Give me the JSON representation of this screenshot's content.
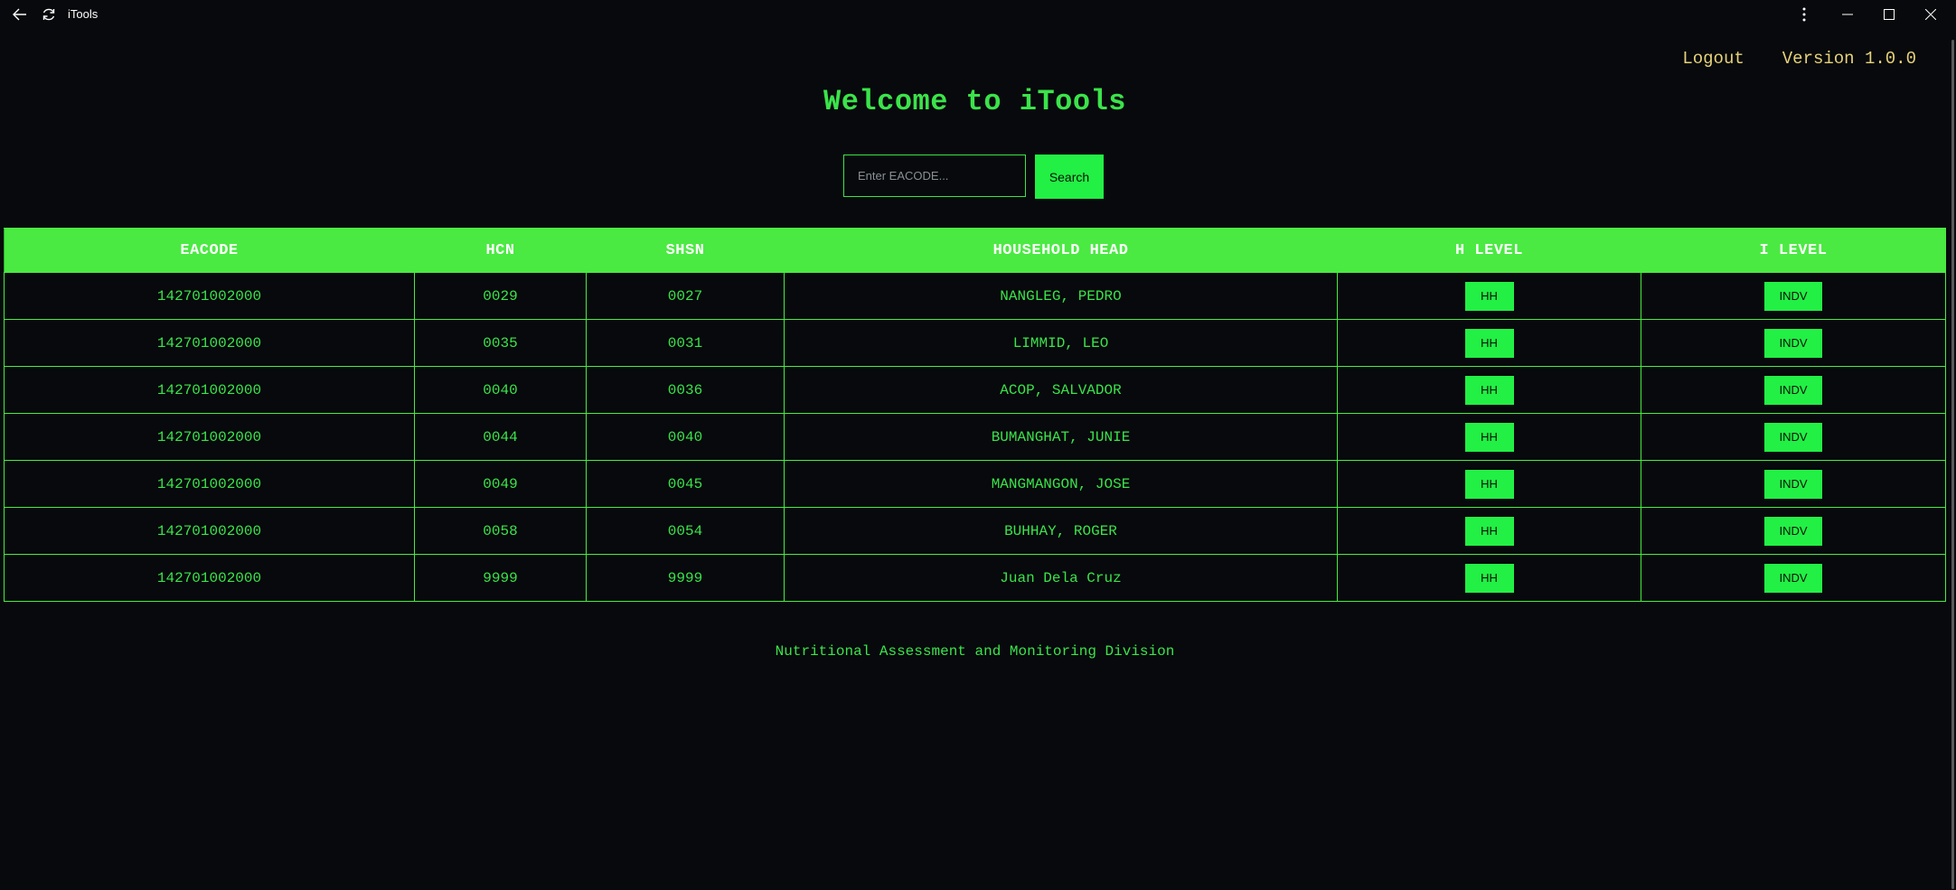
{
  "window": {
    "title": "iTools"
  },
  "header": {
    "logout_label": "Logout",
    "version_label": "Version 1.0.0"
  },
  "main": {
    "welcome": "Welcome to iTools",
    "search": {
      "placeholder": "Enter EACODE...",
      "value": "",
      "button_label": "Search"
    },
    "table": {
      "columns": [
        "EACODE",
        "HCN",
        "SHSN",
        "HOUSEHOLD HEAD",
        "H LEVEL",
        "I LEVEL"
      ],
      "rows": [
        {
          "eacode": "142701002000",
          "hcn": "0029",
          "shsn": "0027",
          "head": "NANGLEG, PEDRO",
          "h_level": "HH",
          "i_level": "INDV"
        },
        {
          "eacode": "142701002000",
          "hcn": "0035",
          "shsn": "0031",
          "head": "LIMMID, LEO",
          "h_level": "HH",
          "i_level": "INDV"
        },
        {
          "eacode": "142701002000",
          "hcn": "0040",
          "shsn": "0036",
          "head": "ACOP, SALVADOR",
          "h_level": "HH",
          "i_level": "INDV"
        },
        {
          "eacode": "142701002000",
          "hcn": "0044",
          "shsn": "0040",
          "head": "BUMANGHAT, JUNIE",
          "h_level": "HH",
          "i_level": "INDV"
        },
        {
          "eacode": "142701002000",
          "hcn": "0049",
          "shsn": "0045",
          "head": "MANGMANGON, JOSE",
          "h_level": "HH",
          "i_level": "INDV"
        },
        {
          "eacode": "142701002000",
          "hcn": "0058",
          "shsn": "0054",
          "head": "BUHHAY, ROGER",
          "h_level": "HH",
          "i_level": "INDV"
        },
        {
          "eacode": "142701002000",
          "hcn": "9999",
          "shsn": "9999",
          "head": "Juan Dela Cruz",
          "h_level": "HH",
          "i_level": "INDV"
        }
      ]
    }
  },
  "footer": {
    "text": "Nutritional Assessment and Monitoring Division"
  },
  "icons": {
    "back": "back-arrow-icon",
    "refresh": "refresh-icon",
    "more": "more-vertical-icon",
    "minimize": "minimize-icon",
    "maximize": "maximize-icon",
    "close": "close-icon"
  },
  "colors": {
    "background": "#07090c",
    "accent_green": "#22f044",
    "header_green": "#4aea42",
    "text_green": "#3be34a",
    "link_yellow": "#e6d27a"
  }
}
